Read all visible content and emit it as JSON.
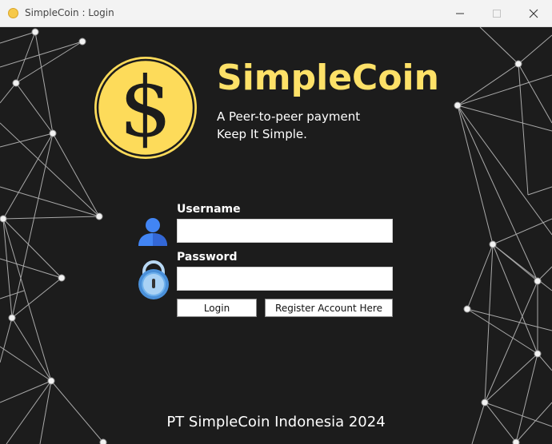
{
  "window": {
    "title": "SimpleCoin : Login",
    "icon": "coin-icon",
    "controls": [
      "minimize-icon",
      "maximize-icon",
      "close-icon"
    ]
  },
  "branding": {
    "name": "SimpleCoin",
    "tagline_line1": "A Peer-to-peer payment",
    "tagline_line2": "Keep It Simple.",
    "logo_symbol": "$",
    "accent_color": "#fde168",
    "coin_color": "#fddb5a"
  },
  "form": {
    "username_label": "Username",
    "username_value": "",
    "password_label": "Password",
    "password_value": "",
    "user_icon": "user-icon",
    "lock_icon": "lock-icon",
    "login_button": "Login",
    "register_button": "Register Account Here"
  },
  "footer": {
    "text": "PT SimpleCoin Indonesia 2024"
  }
}
